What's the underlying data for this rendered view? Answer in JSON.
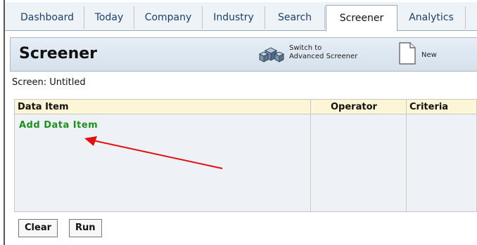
{
  "tabs": [
    {
      "label": "Dashboard"
    },
    {
      "label": "Today"
    },
    {
      "label": "Company"
    },
    {
      "label": "Industry"
    },
    {
      "label": "Search"
    },
    {
      "label": "Screener",
      "active": true
    },
    {
      "label": "Analytics"
    }
  ],
  "header": {
    "title": "Screener",
    "switch_line1": "Switch to",
    "switch_line2": "Advanced Screener",
    "new_label": "New"
  },
  "screen_label": "Screen: Untitled",
  "grid": {
    "columns": [
      "Data Item",
      "Operator",
      "Criteria"
    ],
    "add_label": "Add Data Item"
  },
  "buttons": {
    "clear": "Clear",
    "run": "Run"
  },
  "colors": {
    "link_green": "#1f8f1f",
    "header_cell": "#fdf6d6",
    "arrow": "#e01010"
  }
}
